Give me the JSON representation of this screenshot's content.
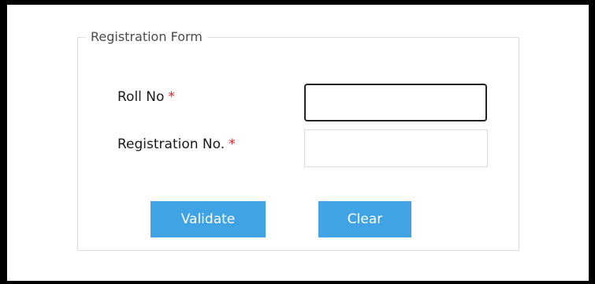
{
  "form": {
    "legend": "Registration Form",
    "roll_no": {
      "label": "Roll No",
      "required_mark": "*",
      "value": "",
      "placeholder": ""
    },
    "registration_no": {
      "label": "Registration No.",
      "required_mark": "*",
      "value": "",
      "placeholder": ""
    },
    "buttons": {
      "validate_label": "Validate",
      "clear_label": "Clear"
    }
  },
  "colors": {
    "button_bg": "#3fa3e4",
    "required_star": "#e02020",
    "page_border": "#000000"
  }
}
